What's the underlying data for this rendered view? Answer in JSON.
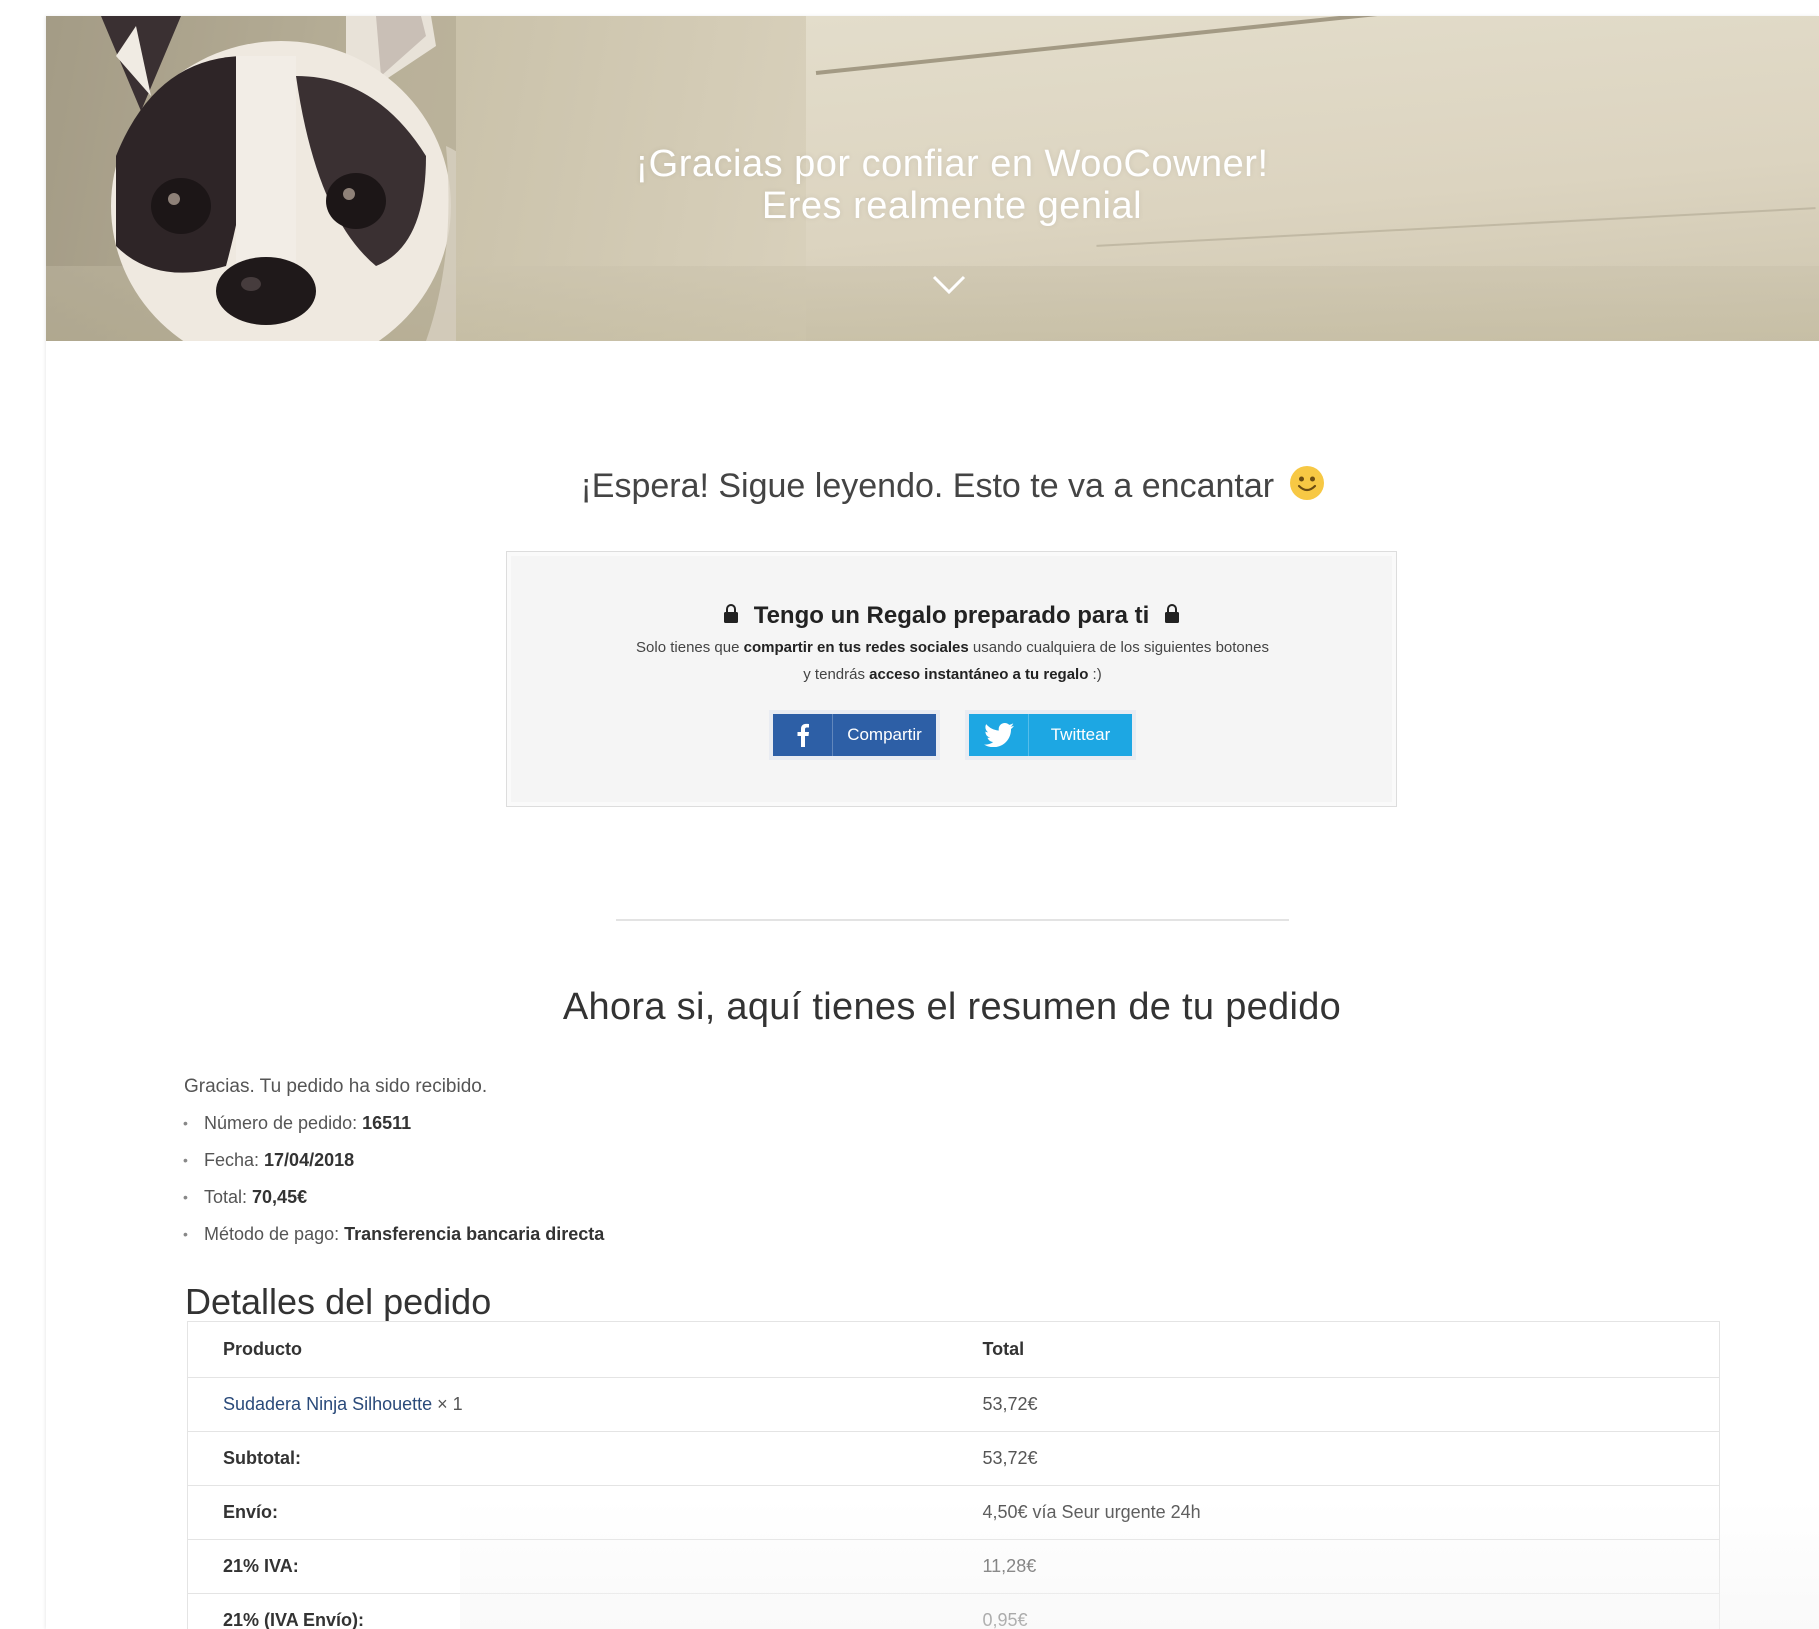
{
  "hero": {
    "line1": "¡Gracias por confiar en WooCowner!",
    "line2": "Eres realmente genial"
  },
  "wait_title": "¡Espera! Sigue leyendo. Esto te va a encantar",
  "gift": {
    "title": "Tengo un Regalo preparado para ti",
    "text_1": "Solo tienes que ",
    "text_bold": "compartir en tus redes sociales",
    "text_2": " usando cualquiera de los siguientes botones",
    "text_3": "y tendrás ",
    "text_bold_2": "acceso instantáneo a tu regalo",
    "text_4": " :)",
    "facebook_label": "Compartir",
    "twitter_label": "Twittear"
  },
  "summary_title": "Ahora si, aquí tienes el resumen de tu pedido",
  "received": "Gracias. Tu pedido ha sido recibido.",
  "order": {
    "number_label": "Número de pedido: ",
    "number": "16511",
    "date_label": "Fecha: ",
    "date": "17/04/2018",
    "total_label": "Total: ",
    "total": "70,45€",
    "method_label": "Método de pago: ",
    "method": "Transferencia bancaria directa"
  },
  "details_title": "Detalles del pedido",
  "table": {
    "header_product": "Producto",
    "header_total": "Total",
    "product_name": "Sudadera Ninja Silhouette",
    "product_qty": " × 1",
    "product_total": "53,72€",
    "rows": [
      {
        "label": "Subtotal:",
        "value": "53,72€"
      },
      {
        "label": "Envío:",
        "value": "4,50€ vía Seur urgente 24h"
      },
      {
        "label": "21% IVA:",
        "value": "11,28€"
      },
      {
        "label": "21% (IVA Envío):",
        "value": "0,95€"
      }
    ]
  },
  "colors": {
    "facebook": "#2d5fa6",
    "twitter": "#1da7e3",
    "smiley": "#f7c844"
  }
}
